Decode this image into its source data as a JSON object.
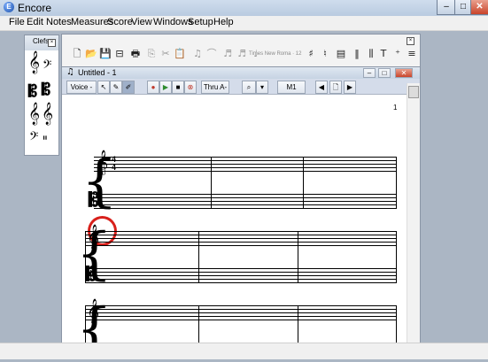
{
  "window": {
    "title": "Encore",
    "app_icon_letter": "E",
    "minimize": "–",
    "maximize": "□",
    "close": "✕"
  },
  "menubar": [
    "File",
    "Edit",
    "Notes",
    "Measures",
    "Score",
    "View",
    "Windows",
    "Setup",
    "Help"
  ],
  "clefs_palette": {
    "title": "Clefs",
    "clefs": [
      {
        "name": "treble-clef",
        "glyph": "𝄞"
      },
      {
        "name": "bass-clef",
        "glyph": "𝄢"
      },
      {
        "name": "alto-clef",
        "glyph": "𝄡"
      },
      {
        "name": "tenor-clef",
        "glyph": "𝄡"
      },
      {
        "name": "treble-8vb-clef",
        "glyph": "𝄞"
      },
      {
        "name": "treble-8va-clef",
        "glyph": "𝄞"
      },
      {
        "name": "bass-clef-2",
        "glyph": "𝄢"
      },
      {
        "name": "percussion-clef",
        "glyph": "𝄥"
      }
    ]
  },
  "tool_palette": {
    "font_label": "Times New Roma · 12",
    "tools": [
      {
        "name": "new-document-icon",
        "glyph": "🗋"
      },
      {
        "name": "open-folder-icon",
        "glyph": "📂"
      },
      {
        "name": "save-icon",
        "glyph": "💾"
      },
      {
        "name": "insert-page-icon",
        "glyph": "⊟"
      },
      {
        "name": "print-icon",
        "glyph": "🖶"
      },
      {
        "name": "copy-icon",
        "glyph": "⎘",
        "dim": true
      },
      {
        "name": "cut-icon",
        "glyph": "✂",
        "dim": true
      },
      {
        "name": "paste-icon",
        "glyph": "📋",
        "dim": true
      },
      {
        "name": "tie-icon",
        "glyph": "♫",
        "dim": true
      },
      {
        "name": "slur-icon",
        "glyph": "⌒",
        "dim": true
      },
      {
        "name": "beam-icon",
        "glyph": "♬",
        "dim": true
      },
      {
        "name": "beam-flat-icon",
        "glyph": "♬",
        "dim": true
      },
      {
        "name": "tuplet-icon",
        "glyph": "♩",
        "dim": true
      },
      {
        "name": "chord-icon",
        "glyph": "♯",
        "dim": false
      },
      {
        "name": "transpose-icon",
        "glyph": "♮",
        "dim": false
      },
      {
        "name": "measure-icon",
        "glyph": "▤",
        "dim": false
      },
      {
        "name": "barline-icon",
        "glyph": "‖",
        "dim": false
      },
      {
        "name": "spacer-icon",
        "glyph": "⫼",
        "dim": false
      },
      {
        "name": "text-icon",
        "glyph": "T",
        "dim": false
      },
      {
        "name": "lyrics-icon",
        "glyph": "⁺",
        "dim": false
      },
      {
        "name": "staff-list-icon",
        "glyph": "≡",
        "dim": false
      }
    ]
  },
  "score_window": {
    "title": "Untitled - 1",
    "voice_label": "Voice -",
    "thru_label": "Thru A-",
    "measure_label": "M1",
    "page_number": "1",
    "time_signature": {
      "top": "4",
      "bottom": "4"
    }
  },
  "status": ""
}
